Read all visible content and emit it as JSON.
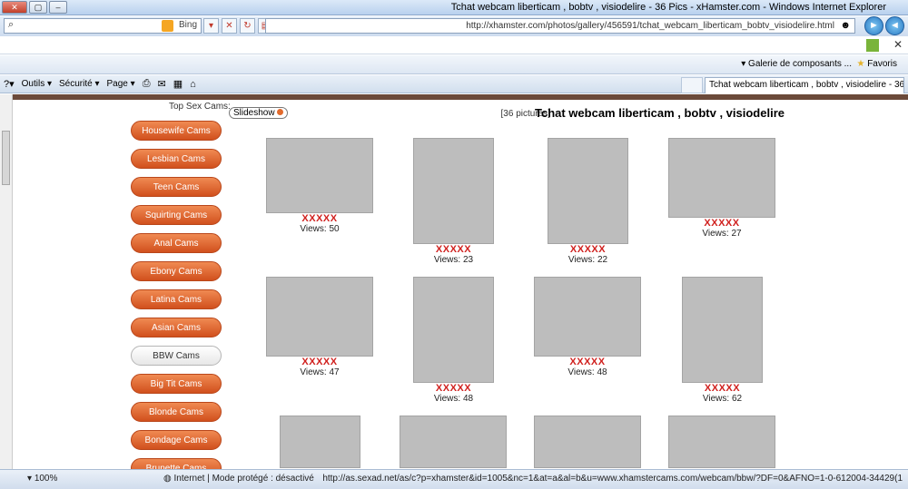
{
  "window": {
    "title": "Tchat webcam liberticam , bobtv , visiodelire - 36 Pics - xHamster.com - Windows Internet Explorer"
  },
  "address": {
    "url": "http://xhamster.com/photos/gallery/456591/tchat_webcam_liberticam_bobtv_visiodelire.html",
    "search_label": "Bing"
  },
  "favorites": {
    "favoris": "Favoris",
    "galerie": "Galerie de composants ..."
  },
  "tab": {
    "label": "Tchat webcam liberticam , bobtv , visiodelire - 36..."
  },
  "commands": {
    "page": "Page",
    "securite": "Sécurité",
    "outils": "Outils"
  },
  "sidebar": {
    "label": "Top Sex Cams:",
    "items": [
      "Housewife Cams",
      "Lesbian Cams",
      "Teen Cams",
      "Squirting Cams",
      "Anal Cams",
      "Ebony Cams",
      "Latina Cams",
      "Asian Cams",
      "BBW Cams",
      "Big Tit Cams",
      "Blonde Cams",
      "Bondage Cams",
      "Brunette Cams"
    ]
  },
  "gallery": {
    "title": "Tchat webcam liberticam , bobtv , visiodelire",
    "count": "[36 pictures]",
    "slideshow": "Slideshow",
    "rating": "XXXXX",
    "tiles": [
      {
        "views": "Views: 50"
      },
      {
        "views": "Views: 23"
      },
      {
        "views": "Views: 22"
      },
      {
        "views": "Views: 27"
      },
      {
        "views": "Views: 47"
      },
      {
        "views": "Views: 48"
      },
      {
        "views": "Views: 48"
      },
      {
        "views": "Views: 62"
      },
      {
        "views": ""
      },
      {
        "views": ""
      },
      {
        "views": ""
      },
      {
        "views": ""
      }
    ]
  },
  "status": {
    "url": "http://as.sexad.net/as/c?p=xhamster&id=1005&nc=1&at=a&al=b&u=www.xhamstercams.com/webcam/bbw/?DF=0&AFNO=1-0-612004-34429(1",
    "zone": "Internet | Mode protégé : désactivé",
    "zoom": "100%"
  }
}
